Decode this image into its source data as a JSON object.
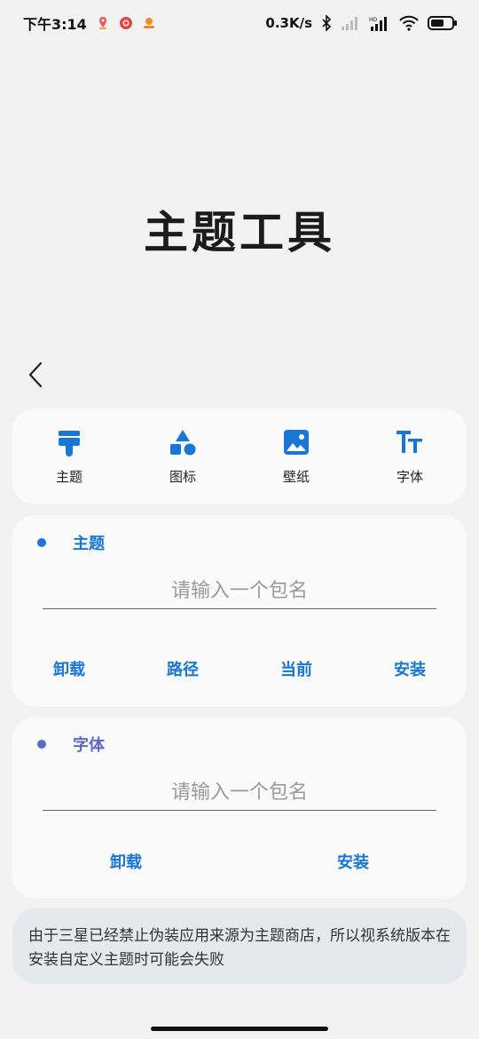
{
  "status_bar": {
    "time": "下午3:14",
    "speed": "0.3K/s",
    "icons": [
      "location-icon",
      "record-icon",
      "app-notification-icon",
      "bluetooth-icon",
      "signal-icon",
      "hd-signal-icon",
      "wifi-icon",
      "battery-icon"
    ]
  },
  "title": "主题工具",
  "nav": {
    "items": [
      {
        "label": "主题",
        "icon": "paint-brush-icon"
      },
      {
        "label": "图标",
        "icon": "shapes-icon"
      },
      {
        "label": "壁纸",
        "icon": "image-icon"
      },
      {
        "label": "字体",
        "icon": "font-icon"
      }
    ]
  },
  "theme_section": {
    "title": "主题",
    "dot_color": "#1976d2",
    "input_placeholder": "请输入一个包名",
    "actions": [
      "卸载",
      "路径",
      "当前",
      "安装"
    ]
  },
  "font_section": {
    "title": "字体",
    "dot_color": "#5c6bc0",
    "input_placeholder": "请输入一个包名",
    "actions": [
      "卸载",
      "安装"
    ]
  },
  "notice": "由于三星已经禁止伪装应用来源为主题商店，所以视系统版本在安装自定义主题时可能会失败",
  "colors": {
    "accent": "#1976d2",
    "background": "#f2f2f2",
    "card": "#fafafa",
    "notice_bg": "#e4e9ef"
  }
}
